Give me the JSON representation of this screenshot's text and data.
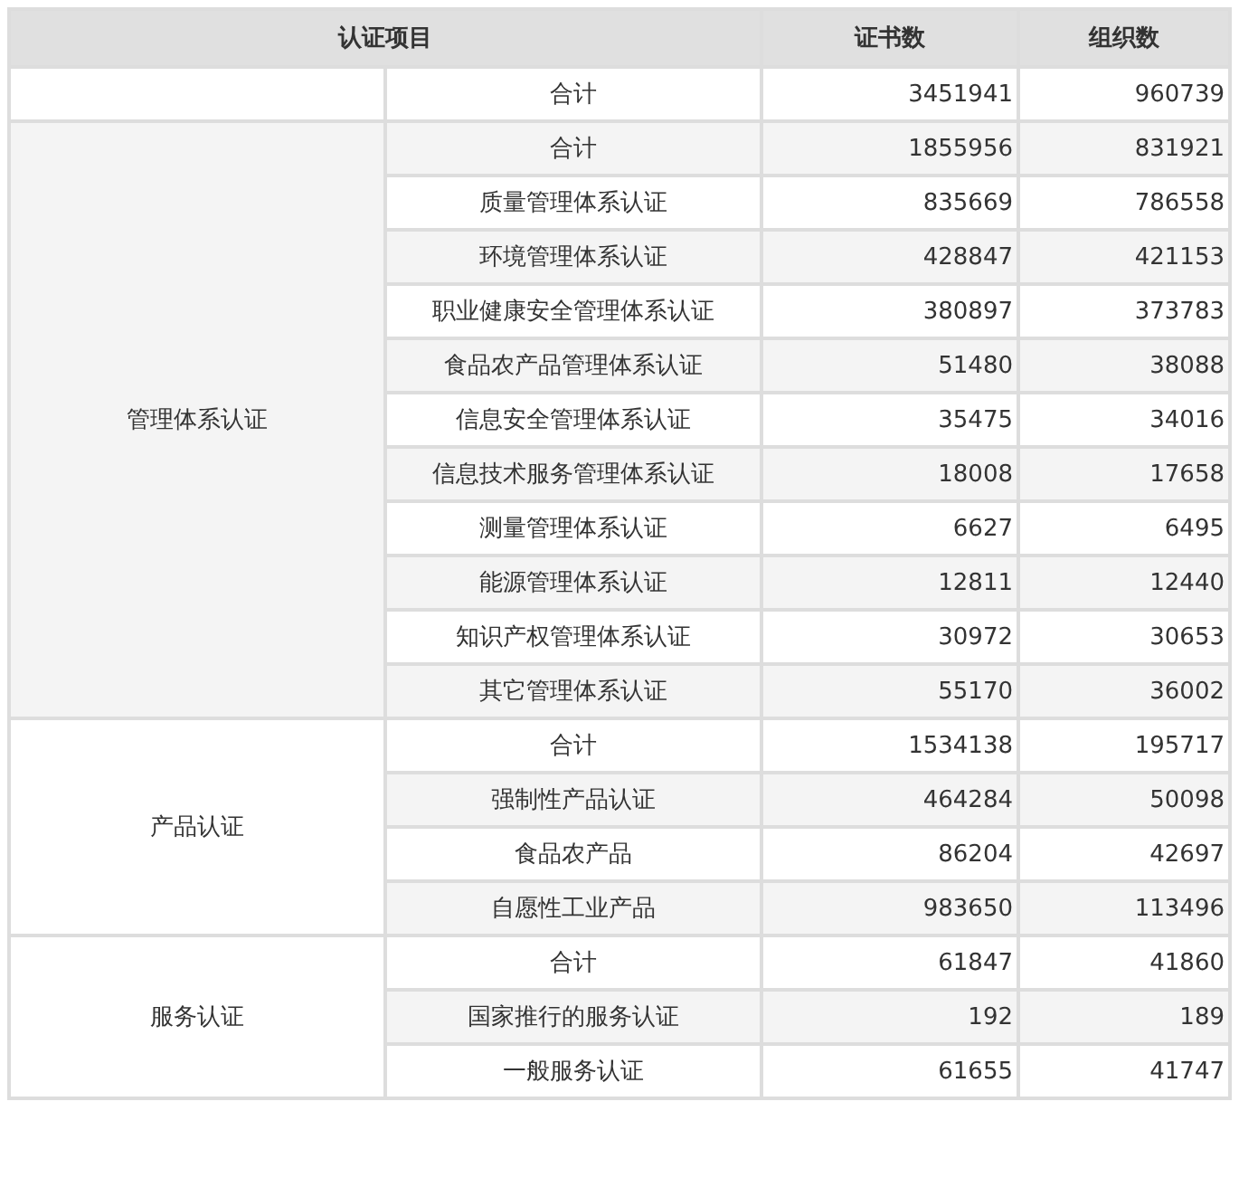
{
  "table": {
    "columns": [
      {
        "label": "认证项目"
      },
      {
        "label": "证书数"
      },
      {
        "label": "组织数"
      }
    ],
    "groups": [
      {
        "rows": [
          {
            "item": "合计",
            "certificates": "3451941",
            "organizations": "960739"
          }
        ]
      },
      {
        "label": "管理体系认证",
        "rows": [
          {
            "item": "合计",
            "certificates": "1855956",
            "organizations": "831921"
          },
          {
            "item": "质量管理体系认证",
            "certificates": "835669",
            "organizations": "786558"
          },
          {
            "item": "环境管理体系认证",
            "certificates": "428847",
            "organizations": "421153"
          },
          {
            "item": "职业健康安全管理体系认证",
            "certificates": "380897",
            "organizations": "373783"
          },
          {
            "item": "食品农产品管理体系认证",
            "certificates": "51480",
            "organizations": "38088"
          },
          {
            "item": "信息安全管理体系认证",
            "certificates": "35475",
            "organizations": "34016"
          },
          {
            "item": "信息技术服务管理体系认证",
            "certificates": "18008",
            "organizations": "17658"
          },
          {
            "item": "测量管理体系认证",
            "certificates": "6627",
            "organizations": "6495"
          },
          {
            "item": "能源管理体系认证",
            "certificates": "12811",
            "organizations": "12440"
          },
          {
            "item": "知识产权管理体系认证",
            "certificates": "30972",
            "organizations": "30653"
          },
          {
            "item": "其它管理体系认证",
            "certificates": "55170",
            "organizations": "36002"
          }
        ]
      },
      {
        "label": "产品认证",
        "rows": [
          {
            "item": "合计",
            "certificates": "1534138",
            "organizations": "195717"
          },
          {
            "item": "强制性产品认证",
            "certificates": "464284",
            "organizations": "50098"
          },
          {
            "item": "食品农产品",
            "certificates": "86204",
            "organizations": "42697"
          },
          {
            "item": "自愿性工业产品",
            "certificates": "983650",
            "organizations": "113496"
          }
        ]
      },
      {
        "label": "服务认证",
        "rows": [
          {
            "item": "合计",
            "certificates": "61847",
            "organizations": "41860"
          },
          {
            "item": "国家推行的服务认证",
            "certificates": "192",
            "organizations": "189"
          },
          {
            "item": "一般服务认证",
            "certificates": "61655",
            "organizations": "41747"
          }
        ]
      }
    ]
  }
}
